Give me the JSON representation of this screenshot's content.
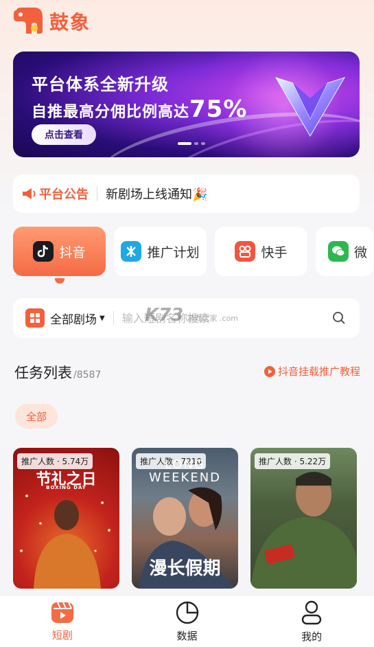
{
  "app": {
    "name": "鼓象"
  },
  "banner": {
    "line1": "平台体系全新升级",
    "line2_prefix": "自推最高分佣比例高达",
    "line2_value": "75%",
    "button_label": "点击查看"
  },
  "notice": {
    "tag": "平台公告",
    "text": "新剧场上线通知🎉"
  },
  "platform_tabs": [
    {
      "label": "抖音",
      "icon": "douyin-icon",
      "active": true
    },
    {
      "label": "推广计划",
      "icon": "plan-icon",
      "active": false
    },
    {
      "label": "快手",
      "icon": "kuaishou-icon",
      "active": false
    },
    {
      "label": "微",
      "icon": "wechat-icon",
      "active": false
    }
  ],
  "search": {
    "category_label": "全部剧场",
    "placeholder": "输入短剧名称搜索"
  },
  "watermark": {
    "text": "K73",
    "sub": "游戏之家 .com"
  },
  "task_list": {
    "title": "任务列表",
    "count": "/8587",
    "tutorial_link": "抖音挂载推广教程"
  },
  "filter": {
    "chip": "全部"
  },
  "cards": [
    {
      "badge": "推广人数 · 5.74万",
      "title": "节礼之日",
      "subtitle": "BOXING DAY"
    },
    {
      "badge": "推广人数 · 7210",
      "title": "漫长假期",
      "subtitle": "LONG WEEKEND"
    },
    {
      "badge": "推广人数 · 5.22万",
      "title": ""
    }
  ],
  "bottom_nav": [
    {
      "label": "短剧",
      "icon": "clapper-icon",
      "active": true
    },
    {
      "label": "数据",
      "icon": "pie-chart-icon",
      "active": false
    },
    {
      "label": "我的",
      "icon": "user-icon",
      "active": false
    }
  ],
  "colors": {
    "brand": "#f2603c",
    "active_tab": "#f46b45",
    "chip_bg": "#fde5dc"
  }
}
